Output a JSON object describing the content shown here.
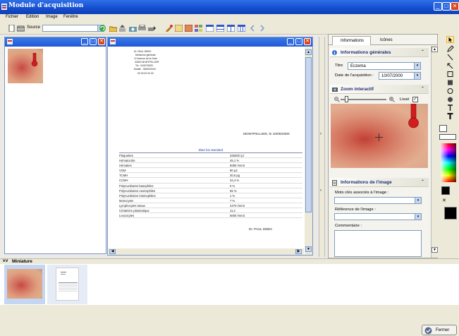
{
  "window": {
    "title": "Module d'acquisition"
  },
  "menu": {
    "items": [
      "Fichier",
      "Edition",
      "Image",
      "Fenêtre"
    ]
  },
  "toolbar": {
    "source_label": "Source",
    "source_value": ""
  },
  "document": {
    "header_lines": [
      "Dr. PAUL DEBO",
      "Médecine générale",
      "12 Avenue de la Gare",
      "34000 MONTPELLIER",
      "Tel : 04/67/00/00",
      "Mobile : 06/00/00/00",
      "00 00 00 00 00"
    ],
    "date_line": "MONTPELLIER, le 10/06/2000",
    "table_title": "bilan bio standard",
    "rows": [
      [
        "Plaquettes",
        "325000 /µl"
      ],
      [
        "Hématocrite",
        "45,1 %"
      ],
      [
        "Hématies",
        "5080 /mm3"
      ],
      [
        "VGM",
        "90 µ3"
      ],
      [
        "TCMH",
        "30,6 pg"
      ],
      [
        "CCMH",
        "34,4 %"
      ],
      [
        "Polynucléaires basophiles",
        "0 %"
      ],
      [
        "Polynucléaires neutrophiles",
        "55 %"
      ],
      [
        "Polynucléaires éosinophiles",
        "1 %"
      ],
      [
        "Monocytes",
        "7 %"
      ],
      [
        "Lymphocytes totaux",
        "2470 /mm3"
      ],
      [
        "Créatinine plasmatique",
        "11,2"
      ],
      [
        "Leucocytes",
        "5000 /mm3"
      ]
    ],
    "signature": "Dr. PAUL DEBO"
  },
  "right_panel": {
    "tabs": [
      "Informations",
      "Icônes"
    ],
    "general": {
      "title": "Informations générales",
      "titre_label": "Titre",
      "titre_value": "Eczema",
      "date_label": "Date de l'acquisition :",
      "date_value": "10/07/2000"
    },
    "zoom": {
      "title": "Zoom interactif",
      "lisse_label": "Lissé"
    },
    "image_info": {
      "title": "Informations de l'image",
      "keywords_label": "Mots clés associés à l'image :",
      "reference_label": "Référence de l'image :",
      "comment_label": "Commentaire :"
    }
  },
  "miniature": {
    "title": "Miniature"
  },
  "footer": {
    "close_label": "Fermer"
  },
  "colors": {
    "titlebar": "#1550cf",
    "accent": "#2c6ae3",
    "close": "#d9461f",
    "marker": "#d41c1c"
  },
  "icons": [
    "app-icon",
    "new-doc-icon",
    "refresh-icon",
    "scanner-icon",
    "print-icon",
    "arrow-left-icon",
    "arrow-right-icon",
    "pointer-icon",
    "pencil-icon",
    "line-icon",
    "rectangle-icon",
    "ellipse-icon",
    "text-icon",
    "info-icon",
    "camera-icon",
    "zoom-out-icon",
    "zoom-in-icon",
    "close-icon"
  ]
}
